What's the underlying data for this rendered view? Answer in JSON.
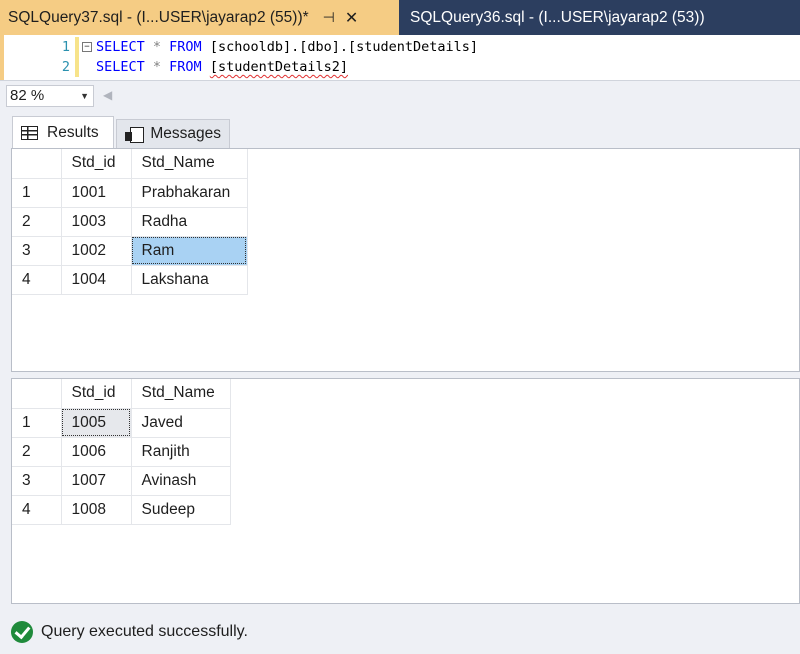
{
  "doc_tabs": {
    "active": {
      "title": "SQLQuery37.sql - (I...USER\\jayarap2 (55))*",
      "pin_glyph": "⊣",
      "close_glyph": "✕"
    },
    "inactive": {
      "title": "SQLQuery36.sql - (I...USER\\jayarap2 (53))"
    }
  },
  "editor": {
    "lines": [
      {
        "number": "1",
        "kw1": "SELECT",
        "star": " * ",
        "kw2": "FROM",
        "target": " [schooldb].[dbo].[studentDetails]"
      },
      {
        "number": "2",
        "kw1": "SELECT",
        "star": " * ",
        "kw2": "FROM",
        "target": "[studentDetails2]"
      }
    ],
    "collapse_glyph": "−"
  },
  "zoom": {
    "value": "82 %",
    "arrow": "▼",
    "scroll_left": "◀"
  },
  "result_tabs": {
    "results": "Results",
    "messages": "Messages"
  },
  "results": [
    {
      "columns": [
        "Std_id",
        "Std_Name"
      ],
      "rows": [
        {
          "n": "1",
          "id": "1001",
          "name": "Prabhakaran"
        },
        {
          "n": "2",
          "id": "1003",
          "name": "Radha"
        },
        {
          "n": "3",
          "id": "1002",
          "name": "Ram"
        },
        {
          "n": "4",
          "id": "1004",
          "name": "Lakshana"
        }
      ]
    },
    {
      "columns": [
        "Std_id",
        "Std_Name"
      ],
      "rows": [
        {
          "n": "1",
          "id": "1005",
          "name": "Javed"
        },
        {
          "n": "2",
          "id": "1006",
          "name": "Ranjith"
        },
        {
          "n": "3",
          "id": "1007",
          "name": "Avinash"
        },
        {
          "n": "4",
          "id": "1008",
          "name": "Sudeep"
        }
      ]
    }
  ],
  "status": {
    "message": "Query executed successfully."
  },
  "colors": {
    "tab_active": "#f5cc84",
    "tab_bar": "#2c3e5f",
    "keyword": "#0000ff",
    "selected_cell": "#a9d2f3",
    "success": "#1f8a3b"
  }
}
